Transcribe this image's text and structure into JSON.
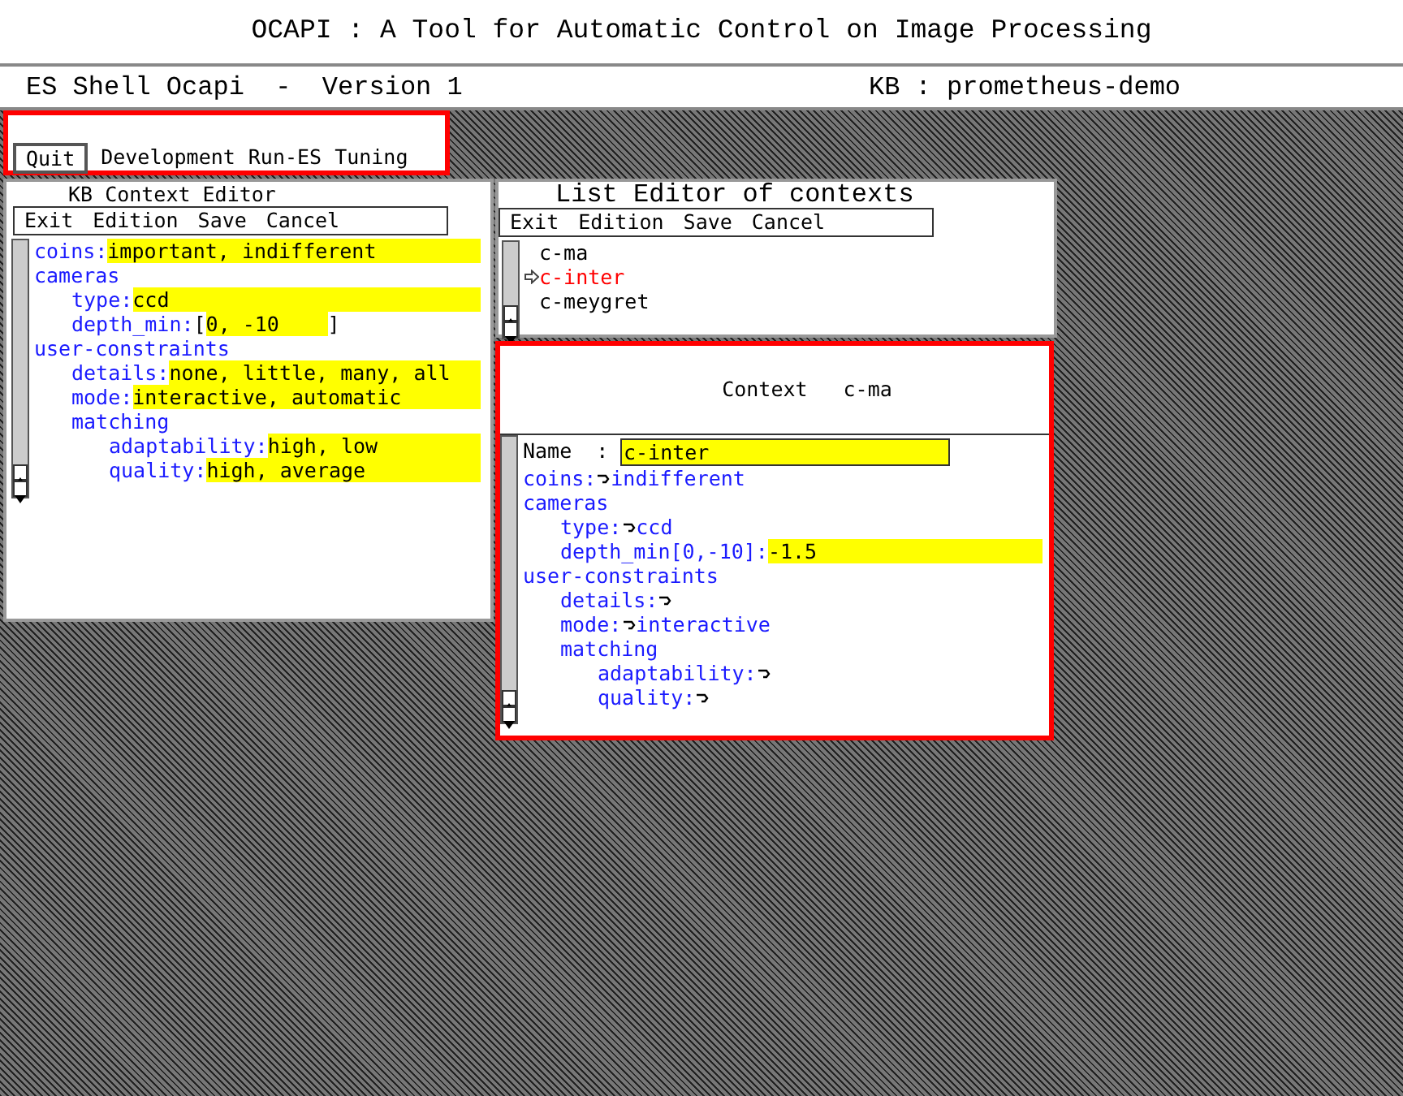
{
  "title": "OCAPI : A Tool for Automatic Control on Image Processing",
  "header": {
    "left": "ES Shell Ocapi  -  Version 1",
    "right": "KB : prometheus-demo"
  },
  "main_menu": {
    "highlighted": true,
    "button": "Quit",
    "items": [
      "Development",
      "Run-ES",
      "Tuning"
    ]
  },
  "kb_editor": {
    "title": "KB Context Editor",
    "menu": [
      "Exit",
      "Edition",
      "Save",
      "Cancel"
    ],
    "tree": [
      {
        "label": "coins:",
        "kind": "value",
        "value": "important, indifferent"
      },
      {
        "label": "cameras",
        "children": [
          {
            "label": "type:",
            "kind": "value",
            "value": "ccd"
          },
          {
            "label": "depth_min:",
            "kind": "bracketed",
            "open": "[",
            "value": "0, -10",
            "close": "]"
          }
        ]
      },
      {
        "label": "user-constraints",
        "children": [
          {
            "label": "details:",
            "kind": "value",
            "value": "none, little, many, all"
          },
          {
            "label": "mode:",
            "kind": "value",
            "value": "interactive, automatic"
          },
          {
            "label": "matching",
            "children": [
              {
                "label": "adaptability:",
                "kind": "value",
                "value": "high, low"
              },
              {
                "label": "quality:",
                "kind": "value",
                "value": "high, average"
              }
            ]
          }
        ]
      }
    ]
  },
  "list_editor": {
    "title": "List Editor of contexts",
    "menu": [
      "Exit",
      "Edition",
      "Save",
      "Cancel"
    ],
    "items": [
      {
        "label": "c-ma",
        "selected": false
      },
      {
        "label": "c-inter",
        "selected": true
      },
      {
        "label": "c-meygret",
        "selected": false
      }
    ]
  },
  "context_window": {
    "title": "Context",
    "context_name": "c-ma",
    "highlighted": true,
    "name_label": "Name  :",
    "name_value": "c-inter",
    "tree": [
      {
        "label": "coins:",
        "kind": "choice",
        "value": "indifferent"
      },
      {
        "label": "cameras",
        "children": [
          {
            "label": "type:",
            "kind": "choice",
            "value": "ccd"
          },
          {
            "label": "depth_min[0,-10]:",
            "kind": "value",
            "value": "-1.5"
          }
        ]
      },
      {
        "label": "user-constraints",
        "children": [
          {
            "label": "details:",
            "kind": "choice"
          },
          {
            "label": "mode:",
            "kind": "choice",
            "value": "interactive"
          },
          {
            "label": "matching",
            "children": [
              {
                "label": "adaptability:",
                "kind": "choice"
              },
              {
                "label": "quality:",
                "kind": "choice"
              }
            ]
          }
        ]
      }
    ]
  }
}
